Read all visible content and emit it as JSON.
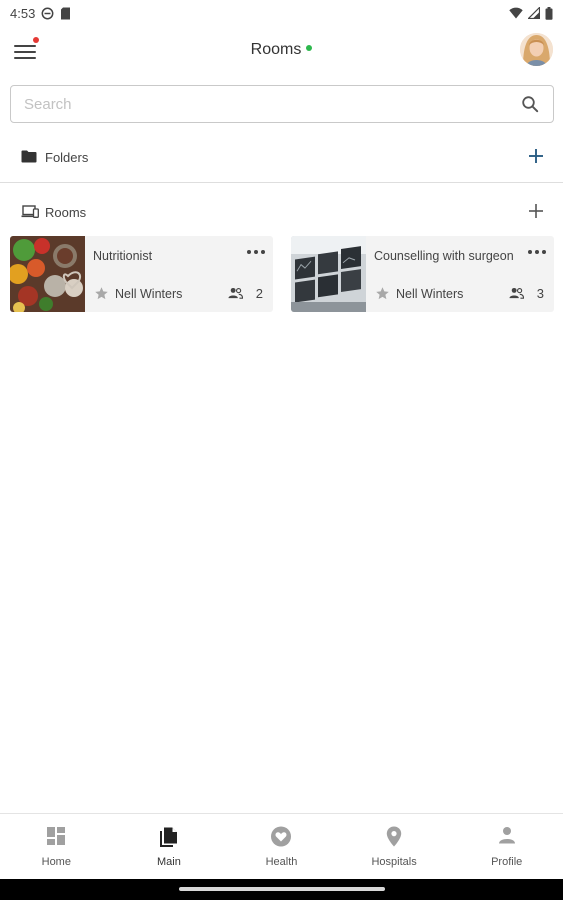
{
  "status_bar": {
    "time": "4:53",
    "icons": [
      "dnd-icon",
      "sim-card-icon",
      "wifi-icon",
      "signal-icon",
      "battery-icon"
    ]
  },
  "app_bar": {
    "title": "Rooms",
    "online_color": "#2db84d",
    "notification_dot_color": "#e53935",
    "menu_icon": "hamburger-menu-icon"
  },
  "search": {
    "placeholder": "Search",
    "value": ""
  },
  "sections": {
    "folders": {
      "label": "Folders",
      "icon": "folder-icon",
      "add_icon": "plus-icon"
    },
    "rooms": {
      "label": "Rooms",
      "icon": "devices-icon",
      "add_icon": "plus-icon"
    }
  },
  "rooms": [
    {
      "title": "Nutritionist",
      "owner": "Nell Winters",
      "members": "2",
      "thumbnail": "vegetables-photo"
    },
    {
      "title": "Counselling with surgeon",
      "owner": "Nell Winters",
      "members": "3",
      "thumbnail": "x-ray-screens-photo"
    }
  ],
  "bottom_nav": {
    "items": [
      {
        "label": "Home",
        "icon": "dashboard-icon",
        "active": false
      },
      {
        "label": "Main",
        "icon": "documents-icon",
        "active": true
      },
      {
        "label": "Health",
        "icon": "heart-icon",
        "active": false
      },
      {
        "label": "Hospitals",
        "icon": "location-pin-icon",
        "active": false
      },
      {
        "label": "Profile",
        "icon": "person-icon",
        "active": false
      }
    ]
  },
  "colors": {
    "accent": "#2a5d84",
    "card_background": "#f3f3f3",
    "inactive_icon": "#9e9e9e"
  }
}
